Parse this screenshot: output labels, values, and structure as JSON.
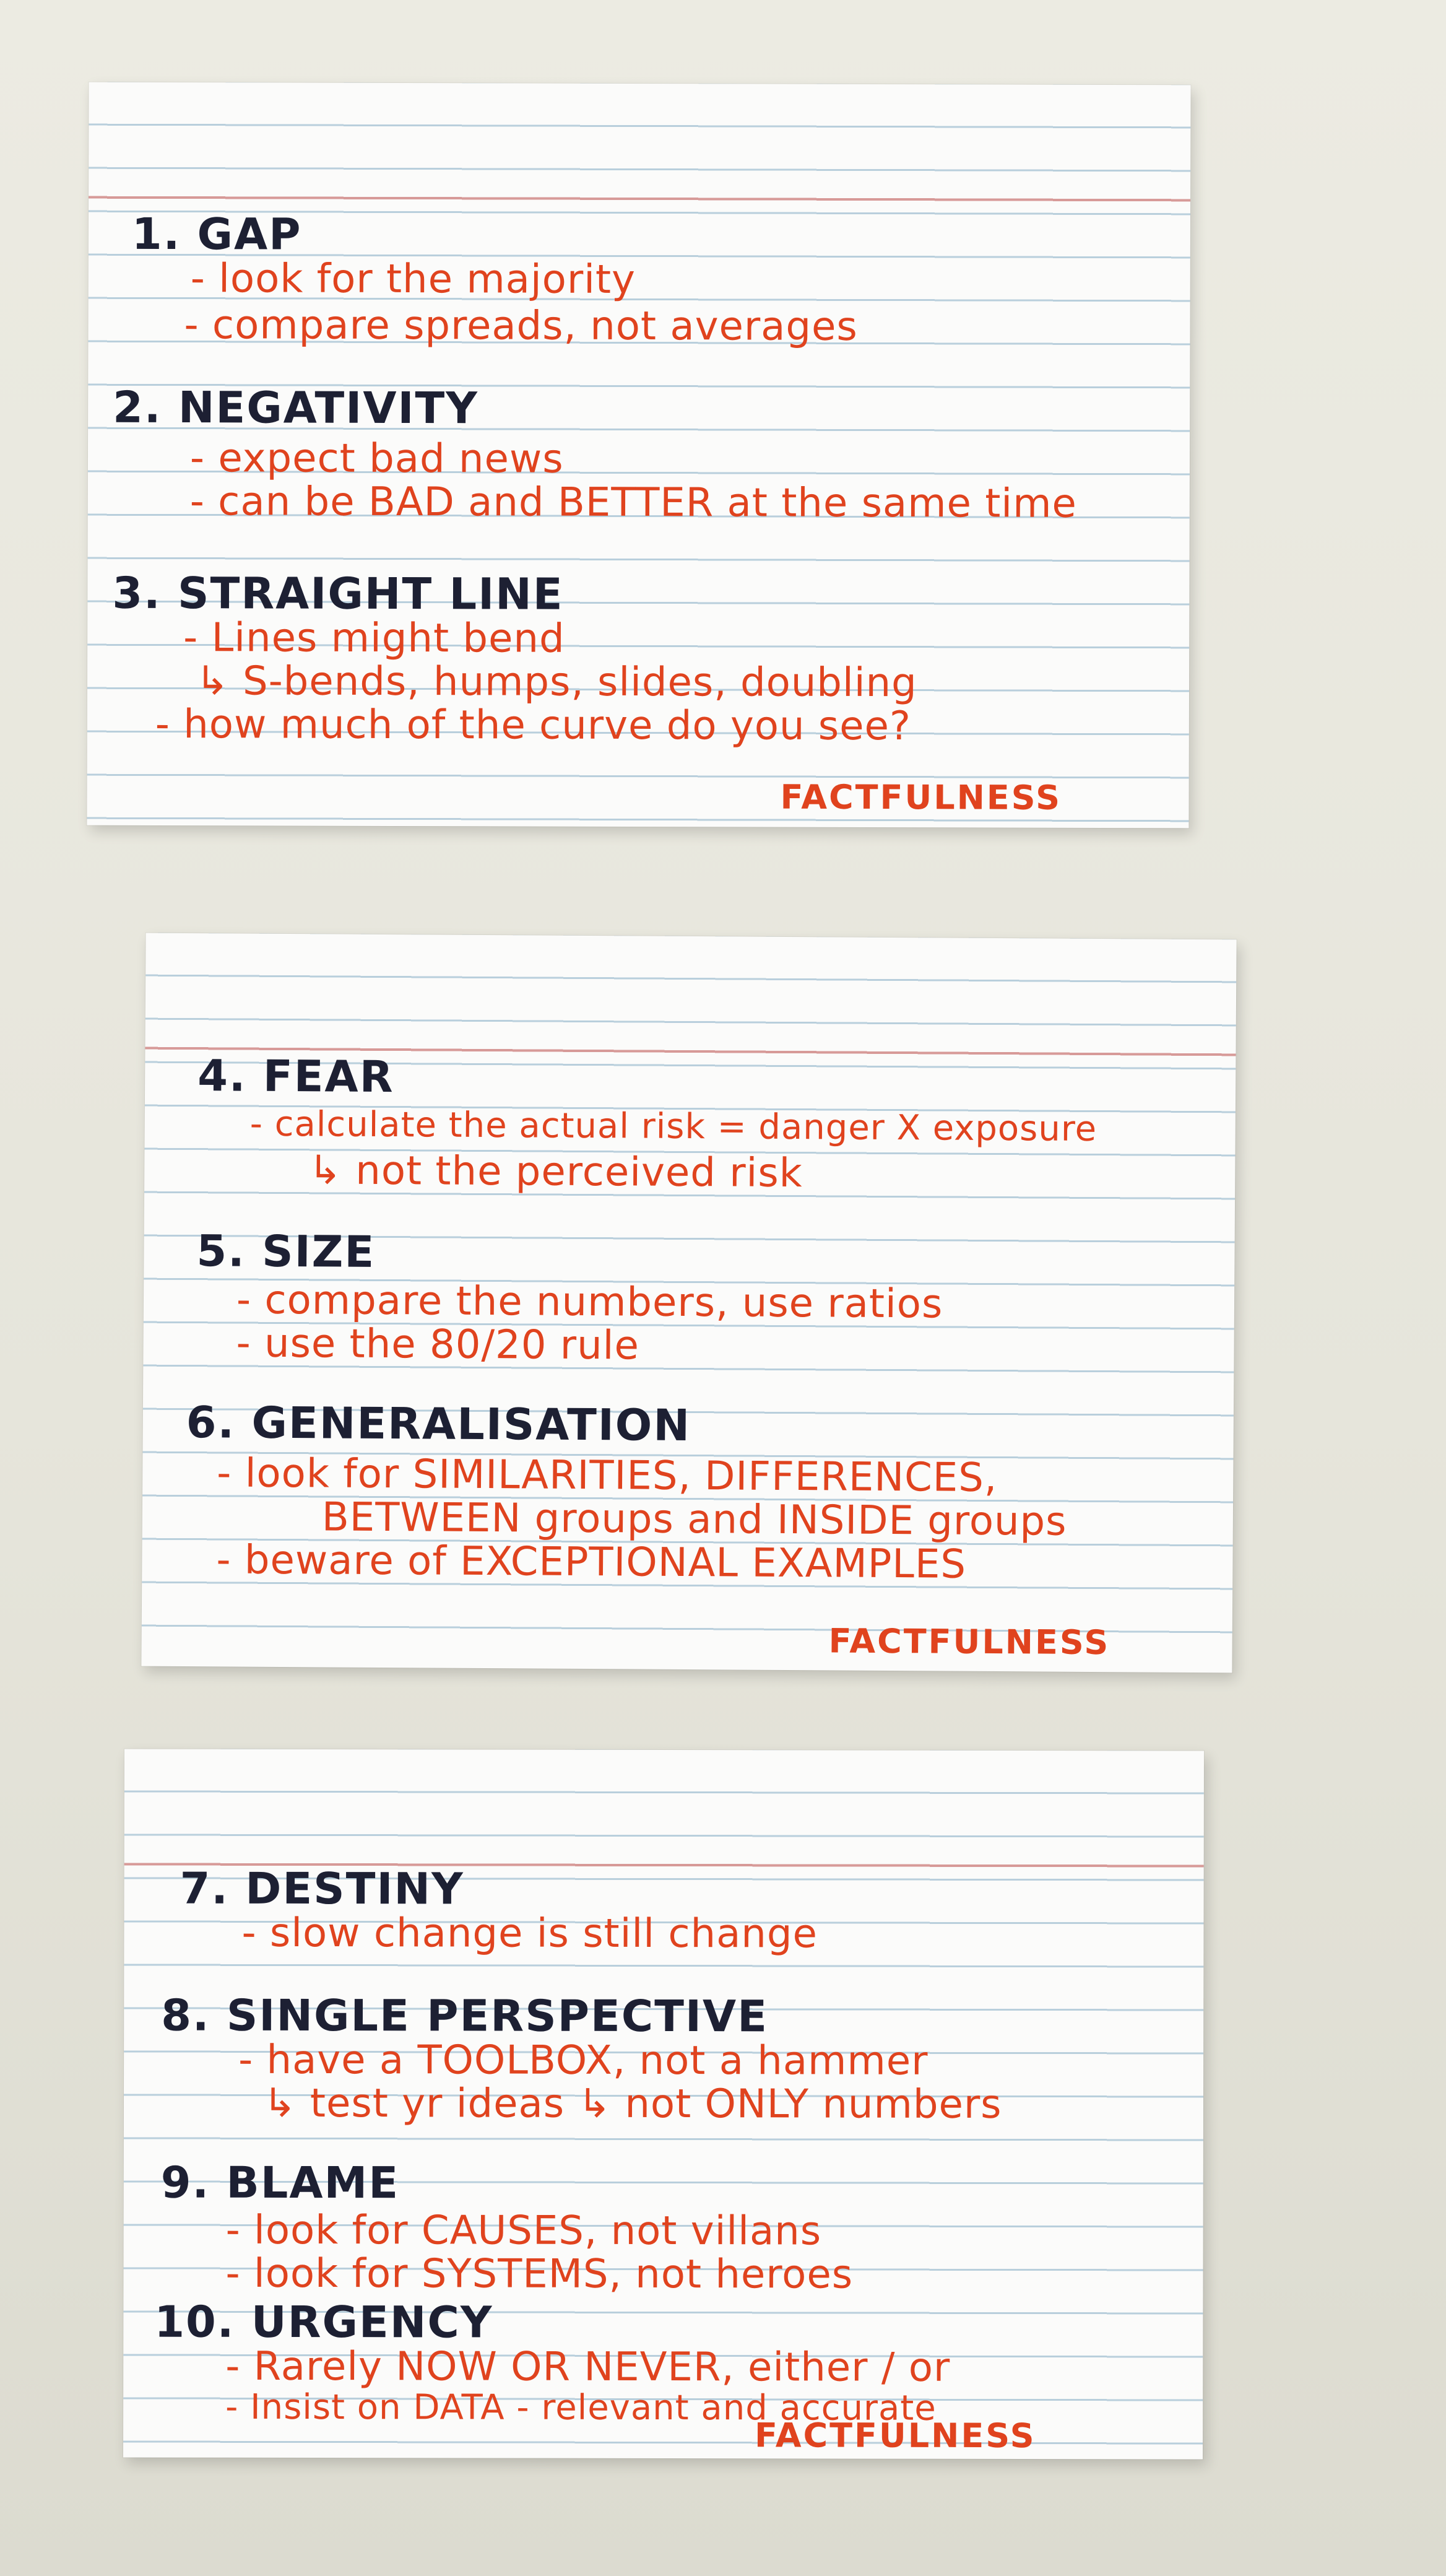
{
  "cards": [
    {
      "sections": [
        {
          "number": "1.",
          "title": "GAP",
          "notes": [
            "- look for the majority",
            "- compare spreads, not averages"
          ]
        },
        {
          "number": "2.",
          "title": "NEGATIVITY",
          "notes": [
            "- expect bad news",
            "- can be BAD and BETTER at the same time"
          ]
        },
        {
          "number": "3.",
          "title": "STRAIGHT LINE",
          "notes": [
            "- Lines might bend",
            "↳ S-bends, humps, slides, doubling",
            "- how much of the curve do you see?"
          ]
        }
      ],
      "brand": "FACTFULNESS"
    },
    {
      "sections": [
        {
          "number": "4.",
          "title": "FEAR",
          "notes": [
            "- calculate the actual risk = danger X exposure",
            "↳ not the perceived risk"
          ]
        },
        {
          "number": "5.",
          "title": "SIZE",
          "notes": [
            "- compare the numbers, use ratios",
            "- use the 80/20 rule"
          ]
        },
        {
          "number": "6.",
          "title": "GENERALISATION",
          "notes": [
            "- look for SIMILARITIES, DIFFERENCES,",
            "BETWEEN groups and INSIDE groups",
            "- beware of EXCEPTIONAL EXAMPLES"
          ]
        }
      ],
      "brand": "FACTFULNESS"
    },
    {
      "sections": [
        {
          "number": "7.",
          "title": "DESTINY",
          "notes": [
            "- slow change is still change"
          ]
        },
        {
          "number": "8.",
          "title": "SINGLE PERSPECTIVE",
          "notes": [
            "- have a TOOLBOX, not a hammer",
            "↳ test yr ideas ↳ not ONLY numbers"
          ]
        },
        {
          "number": "9.",
          "title": "BLAME",
          "notes": [
            "- look for CAUSES, not villans",
            "- look for SYSTEMS, not heroes"
          ]
        },
        {
          "number": "10.",
          "title": "URGENCY",
          "notes": [
            "- Rarely NOW OR NEVER, either / or",
            "- Insist on DATA - relevant and accurate"
          ]
        }
      ],
      "brand": "FACTFULNESS"
    }
  ],
  "colors": {
    "heading_ink": "#1d2033",
    "note_ink": "#e0431e",
    "card_paper": "#fbfbfa",
    "ruled_line": "#b9cfdc",
    "margin_line": "#d79a98",
    "table_surface": "#e9e8de"
  }
}
